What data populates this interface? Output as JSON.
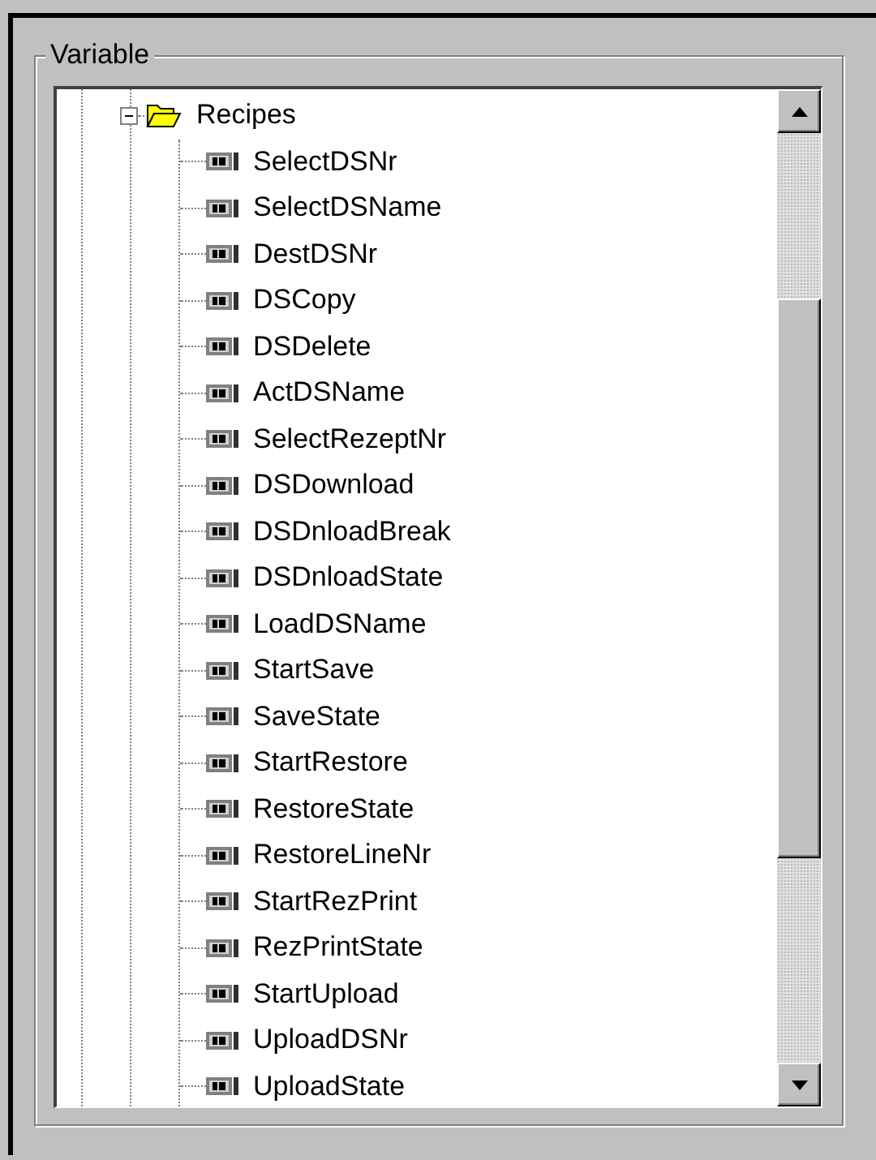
{
  "group": {
    "label": "Variable"
  },
  "tree": [
    {
      "label": "Recipes",
      "expanded": true,
      "children": [
        {
          "label": "SelectDSNr"
        },
        {
          "label": "SelectDSName"
        },
        {
          "label": "DestDSNr"
        },
        {
          "label": "DSCopy"
        },
        {
          "label": "DSDelete"
        },
        {
          "label": "ActDSName"
        },
        {
          "label": "SelectRezeptNr"
        },
        {
          "label": "DSDownload"
        },
        {
          "label": "DSDnloadBreak"
        },
        {
          "label": "DSDnloadState"
        },
        {
          "label": "LoadDSName"
        },
        {
          "label": "StartSave"
        },
        {
          "label": "SaveState"
        },
        {
          "label": "StartRestore"
        },
        {
          "label": "RestoreState"
        },
        {
          "label": "RestoreLineNr"
        },
        {
          "label": "StartRezPrint"
        },
        {
          "label": "RezPrintState"
        },
        {
          "label": "StartUpload"
        },
        {
          "label": "UploadDSNr"
        },
        {
          "label": "UploadState"
        }
      ]
    }
  ]
}
